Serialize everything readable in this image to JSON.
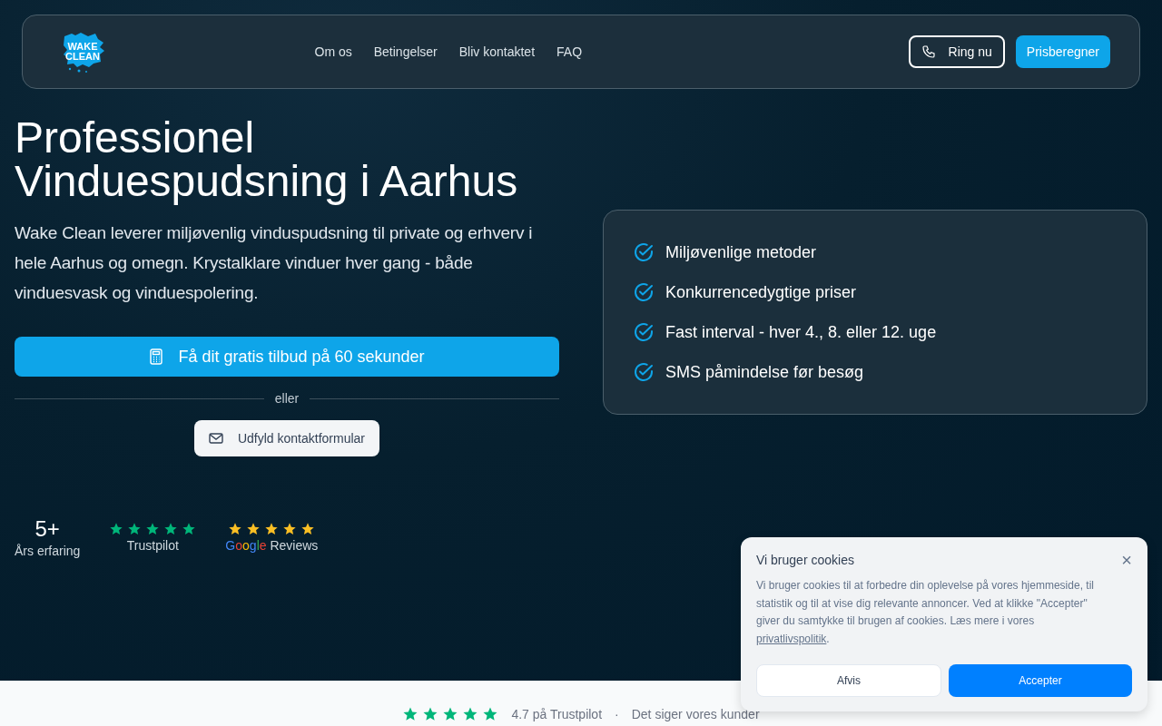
{
  "nav": {
    "logo": [
      "WAKE",
      "CLEAN"
    ],
    "links": [
      "Om os",
      "Betingelser",
      "Bliv kontaktet",
      "FAQ"
    ],
    "call_button": "Ring nu",
    "price_button": "Prisberegner"
  },
  "hero": {
    "title": "Professionel Vinduespudsning i Aarhus",
    "lead": "Wake Clean leverer miljøvenlig vinduspudsning til private og erhverv i hele Aarhus og omegn. Krystalklare vinduer hver gang - både vinduesvask og vinduespolering.",
    "cta": "Få dit gratis tilbud på 60 sekunder",
    "divider": "eller",
    "form_button": "Udfyld kontaktformular"
  },
  "features": [
    "Miljøvenlige metoder",
    "Konkurrencedygtige priser",
    "Fast interval - hver 4., 8. eller 12. uge",
    "SMS påmindelse før besøg"
  ],
  "stats": [
    {
      "kind": "number",
      "value": "5+",
      "label": "Års erfaring"
    },
    {
      "kind": "rating",
      "stars": 5,
      "color": "#00b67a",
      "label": "Trustpilot"
    },
    {
      "kind": "google",
      "stars": 5,
      "color": "#fbbf24",
      "brand": "Google",
      "label": "Reviews"
    }
  ],
  "strip": {
    "stars": 5,
    "rating": "4.7 på Trustpilot",
    "separator": "·",
    "tagline": "Det siger vores kunder"
  },
  "cookie": {
    "title": "Vi bruger cookies",
    "close": "×",
    "text": "Vi bruger cookies til at forbedre din oplevelse på vores hjemmeside, til statistik og til at vise dig relevante annoncer. Ved at klikke \"Accepter\" giver du samtykke til brugen af cookies. Læs mere i vores",
    "link": "privatlivspolitik",
    "end": ".",
    "reject": "Afvis",
    "accept": "Accepter"
  }
}
